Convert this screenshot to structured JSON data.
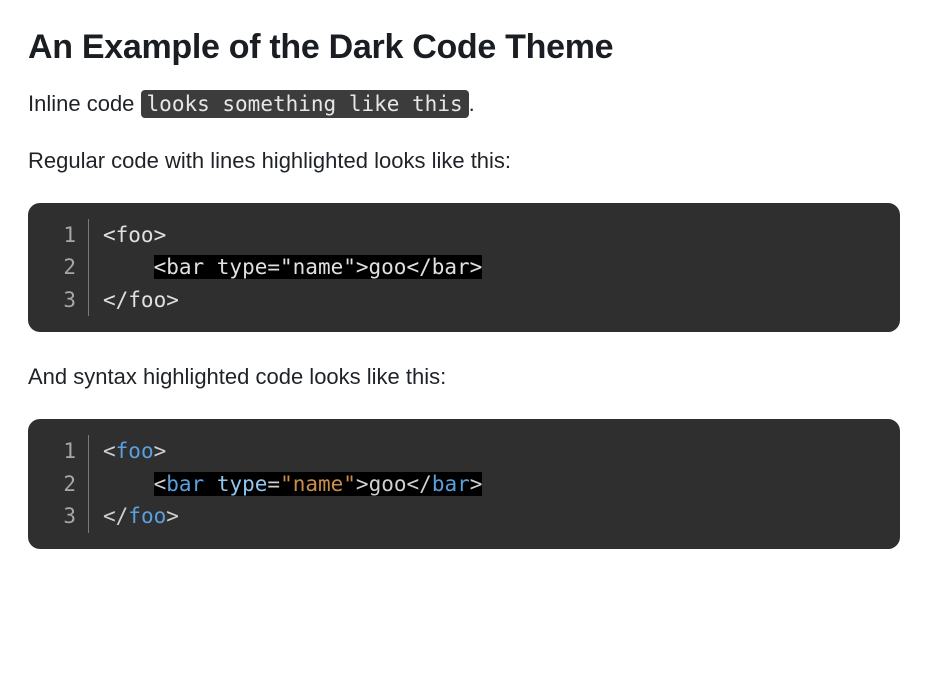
{
  "heading": "An Example of the Dark Code Theme",
  "intro_prefix": "Inline code ",
  "inline_code": "looks something like this",
  "intro_suffix": ".",
  "para1": "Regular code with lines highlighted looks like this:",
  "para2": "And syntax highlighted code looks like this:",
  "block1": {
    "lines": [
      {
        "num": "1",
        "indent": "",
        "plain_before": "<foo>",
        "highlighted": false
      },
      {
        "num": "2",
        "indent": "    ",
        "plain_before": "",
        "highlighted": true,
        "highlight_text": "<bar type=\"name\">goo</bar>"
      },
      {
        "num": "3",
        "indent": "",
        "plain_before": "</foo>",
        "highlighted": false
      }
    ]
  },
  "block2": {
    "lines": [
      {
        "num": "1",
        "indent": "",
        "highlighted": false,
        "tokens": [
          {
            "cls": "tk-punct",
            "t": "<"
          },
          {
            "cls": "tk-tag",
            "t": "foo"
          },
          {
            "cls": "tk-punct",
            "t": ">"
          }
        ]
      },
      {
        "num": "2",
        "indent": "    ",
        "highlighted": true,
        "tokens": [
          {
            "cls": "tk-punct",
            "t": "<"
          },
          {
            "cls": "tk-tag",
            "t": "bar"
          },
          {
            "cls": "plain",
            "t": " "
          },
          {
            "cls": "tk-attr-h",
            "t": "type"
          },
          {
            "cls": "tk-punct",
            "t": "="
          },
          {
            "cls": "tk-string",
            "t": "\"name\""
          },
          {
            "cls": "tk-punct",
            "t": ">"
          },
          {
            "cls": "tk-text",
            "t": "goo"
          },
          {
            "cls": "tk-punct",
            "t": "</"
          },
          {
            "cls": "tk-tag",
            "t": "bar"
          },
          {
            "cls": "tk-punct",
            "t": ">"
          }
        ]
      },
      {
        "num": "3",
        "indent": "",
        "highlighted": false,
        "tokens": [
          {
            "cls": "tk-punct",
            "t": "</"
          },
          {
            "cls": "tk-tag",
            "t": "foo"
          },
          {
            "cls": "tk-punct",
            "t": ">"
          }
        ]
      }
    ]
  }
}
